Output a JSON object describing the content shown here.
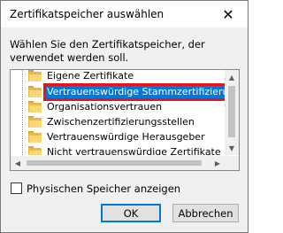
{
  "window": {
    "title": "Zertifikatspeicher auswählen",
    "close_glyph": "✕"
  },
  "description": "Wählen Sie den Zertifikatspeicher, der verwendet werden soll.",
  "tree": {
    "items": [
      {
        "label": "Eigene Zertifikate",
        "icon": "folder-icon"
      },
      {
        "label": "Vertrauenswürdige Stammzertifizierungs",
        "icon": "folder-icon",
        "selected": true
      },
      {
        "label": "Organisationsvertrauen",
        "icon": "folder-icon"
      },
      {
        "label": "Zwischenzertifizierungsstellen",
        "icon": "folder-icon"
      },
      {
        "label": "Vertrauenswürdige Herausgeber",
        "icon": "folder-icon"
      },
      {
        "label": "Nicht vertrauenswürdige Zertifikate",
        "icon": "folder-icon"
      }
    ],
    "highlight_color": "#e8141c"
  },
  "checkbox": {
    "label": "Physischen Speicher anzeigen",
    "checked": false
  },
  "buttons": {
    "ok": "OK",
    "cancel": "Abbrechen"
  },
  "colors": {
    "selection": "#0078d7",
    "folder": "#f8d775"
  }
}
